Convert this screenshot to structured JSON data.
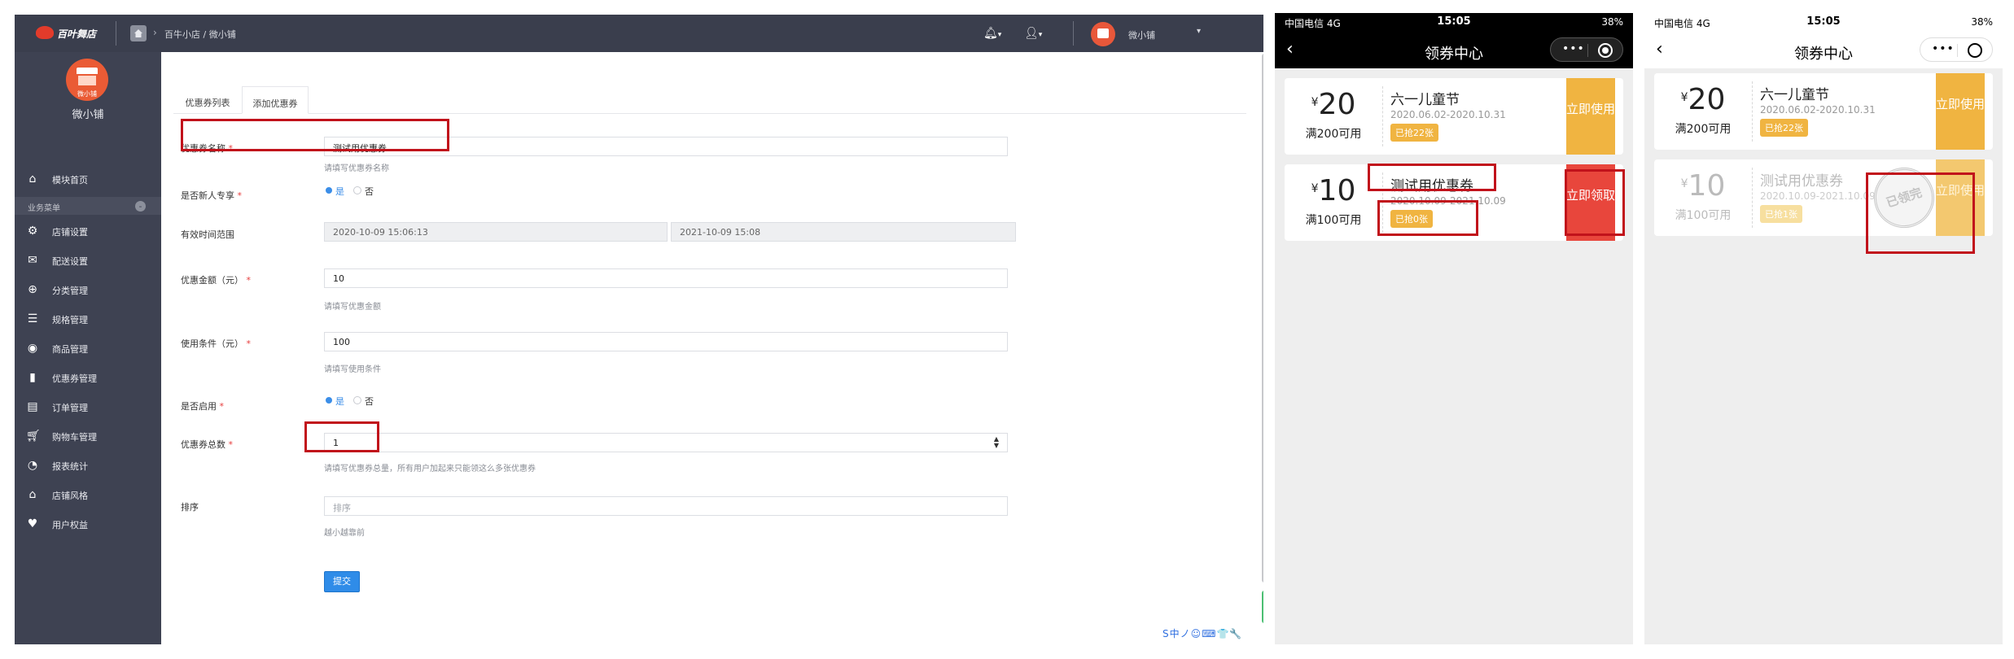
{
  "admin": {
    "logo_text": "百叶舞店",
    "breadcrumb": "百牛小店 / 微小铺",
    "bell_icon": "bell-icon",
    "user_icon": "user-icon",
    "top_user_name": "微小铺",
    "sidebar": {
      "avatar_label": "微小铺",
      "shop_name": "微小铺",
      "home_item": "模块首页",
      "group_label": "业务菜单",
      "items": [
        {
          "label": "店铺设置",
          "icon": "gear-icon"
        },
        {
          "label": "配送设置",
          "icon": "delivery-icon"
        },
        {
          "label": "分类管理",
          "icon": "category-icon"
        },
        {
          "label": "规格管理",
          "icon": "list-icon"
        },
        {
          "label": "商品管理",
          "icon": "goods-icon"
        },
        {
          "label": "优惠券管理",
          "icon": "coupon-icon"
        },
        {
          "label": "订单管理",
          "icon": "order-icon"
        },
        {
          "label": "购物车管理",
          "icon": "cart-icon"
        },
        {
          "label": "报表统计",
          "icon": "chart-icon"
        },
        {
          "label": "店铺风格",
          "icon": "style-icon"
        },
        {
          "label": "用户权益",
          "icon": "heart-icon"
        }
      ]
    },
    "tabs": [
      "优惠券列表",
      "添加优惠券"
    ],
    "form": {
      "name_label": "优惠券名称",
      "name_value": "测试用优惠券",
      "name_help": "请填写优惠券名称",
      "new_user_label": "是否新人专享",
      "new_user_yes": "是",
      "new_user_no": "否",
      "validity_label": "有效时间范围",
      "validity_start": "2020-10-09 15:06:13",
      "validity_end": "2021-10-09 15:08",
      "amount_label": "优惠金额（元）",
      "amount_value": "10",
      "amount_help": "请填写优惠金额",
      "condition_label": "使用条件（元）",
      "condition_value": "100",
      "condition_help": "请填写使用条件",
      "enabled_label": "是否启用",
      "enabled_yes": "是",
      "enabled_no": "否",
      "total_label": "优惠券总数",
      "total_value": "1",
      "total_help": "请填写优惠券总量，所有用户加起来只能领这么多张优惠券",
      "sort_label": "排序",
      "sort_placeholder": "排序",
      "sort_help": "越小越靠前",
      "submit": "提交"
    },
    "ime_bar": "S中ノ☺⌨👕🔧"
  },
  "phone_left": {
    "status_left": "中国电信 4G",
    "time": "15:05",
    "status_right": "38%",
    "title": "领券中心",
    "coupons": [
      {
        "currency": "¥",
        "amount": "20",
        "condition": "满200可用",
        "name": "六一儿童节",
        "dates": "2020.06.02-2020.10.31",
        "badge": "已抢22张",
        "action": "立即使用"
      },
      {
        "currency": "¥",
        "amount": "10",
        "condition": "满100可用",
        "name": "测试用优惠券",
        "dates": "2020.10.09-2021.10.09",
        "badge": "已抢0张",
        "action": "立即领取"
      }
    ]
  },
  "phone_right": {
    "status_left": "中国电信 4G",
    "time": "15:05",
    "status_right": "38%",
    "title": "领券中心",
    "stamp": "已领完",
    "coupons": [
      {
        "currency": "¥",
        "amount": "20",
        "condition": "满200可用",
        "name": "六一儿童节",
        "dates": "2020.06.02-2020.10.31",
        "badge": "已抢22张",
        "action": "立即使用"
      },
      {
        "currency": "¥",
        "amount": "10",
        "condition": "满100可用",
        "name": "测试用优惠券",
        "dates": "2020.10.09-2021.10.09",
        "badge": "已抢1张",
        "action": "立即使用"
      }
    ]
  },
  "colors": {
    "highlight": "#c1121b",
    "coupon_orange": "#f0b441",
    "coupon_red": "#e8463c",
    "sidebar": "#3e4252",
    "primary": "#2f8ce8"
  }
}
